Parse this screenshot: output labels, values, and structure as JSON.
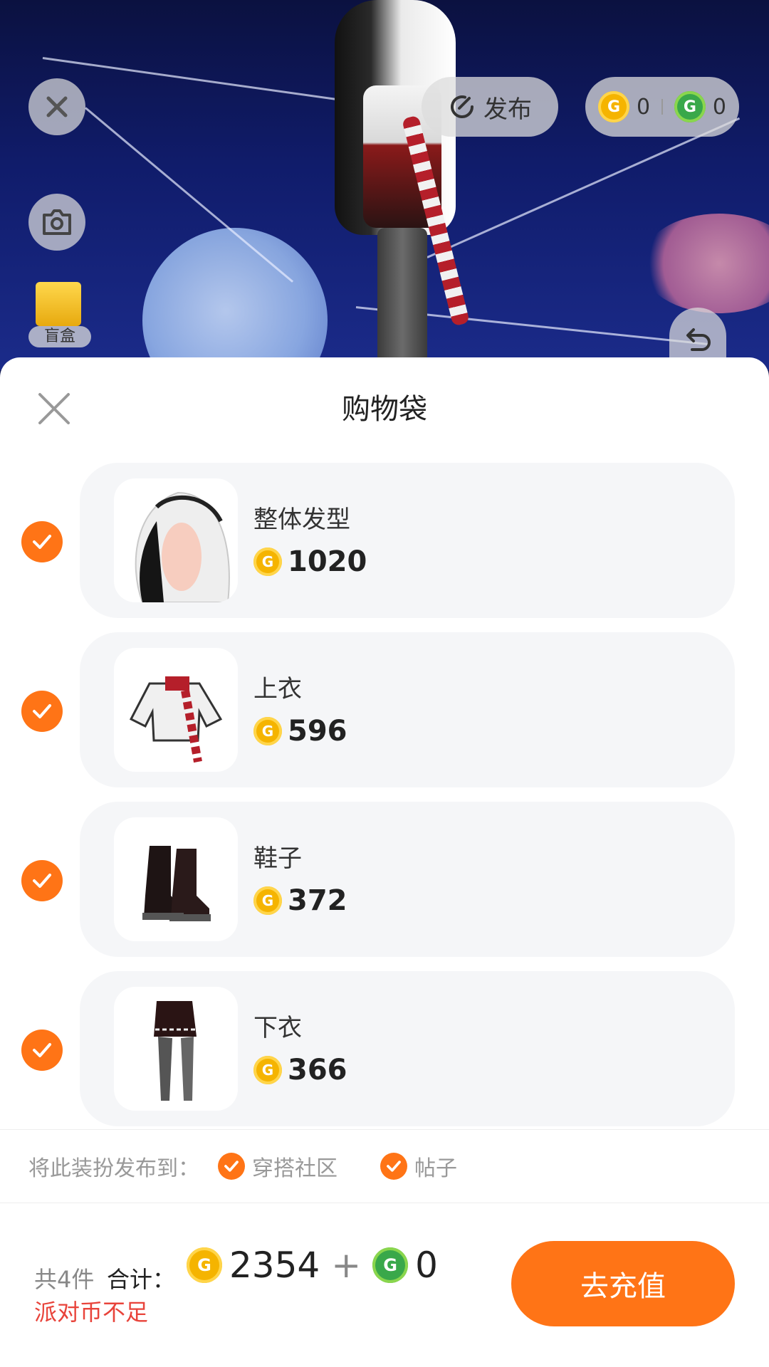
{
  "scene": {
    "publish_label": "发布",
    "gold_balance": "0",
    "green_balance": "0",
    "blind_box_label": "盲盒"
  },
  "sheet": {
    "title": "购物袋",
    "items": [
      {
        "name": "整体发型",
        "price": "1020",
        "checked": true,
        "icon": "hair-thumbnail"
      },
      {
        "name": "上衣",
        "price": "596",
        "checked": true,
        "icon": "top-thumbnail"
      },
      {
        "name": "鞋子",
        "price": "372",
        "checked": true,
        "icon": "shoes-thumbnail"
      },
      {
        "name": "下衣",
        "price": "366",
        "checked": true,
        "icon": "bottom-thumbnail"
      }
    ],
    "publish_to_label": "将此装扮发布到：",
    "publish_options": [
      "穿搭社区",
      "帖子"
    ]
  },
  "footer": {
    "count_label": "共4件",
    "total_label": "合计：",
    "gold_total": "2354",
    "plus": "+",
    "green_total": "0",
    "warning": "派对币不足",
    "recharge_label": "去充值"
  },
  "colors": {
    "accent": "#ff7416",
    "warning": "#e8433a",
    "gold_coin": "#f5b400",
    "green_coin": "#39a84a"
  }
}
